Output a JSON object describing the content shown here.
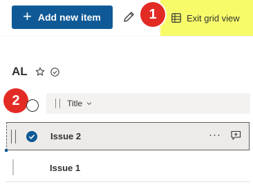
{
  "toolbar": {
    "add_label": "Add new item",
    "add_icon": "plus-icon",
    "edit_icon": "pencil-icon",
    "exit_grid_label": "Exit grid view",
    "exit_grid_icon": "grid-icon",
    "highlight_color": "#f7fb6a",
    "accent_color": "#0f5a96"
  },
  "badges": {
    "one": "1",
    "two": "2",
    "color": "#e32b26"
  },
  "list": {
    "title": "AL",
    "favorite_icon": "star-icon",
    "status_icon": "check-circle-icon"
  },
  "columns": {
    "title_label": "Title"
  },
  "rows": [
    {
      "title": "Issue 2",
      "selected": true,
      "more": "···"
    },
    {
      "title": "Issue 1",
      "selected": false
    }
  ]
}
